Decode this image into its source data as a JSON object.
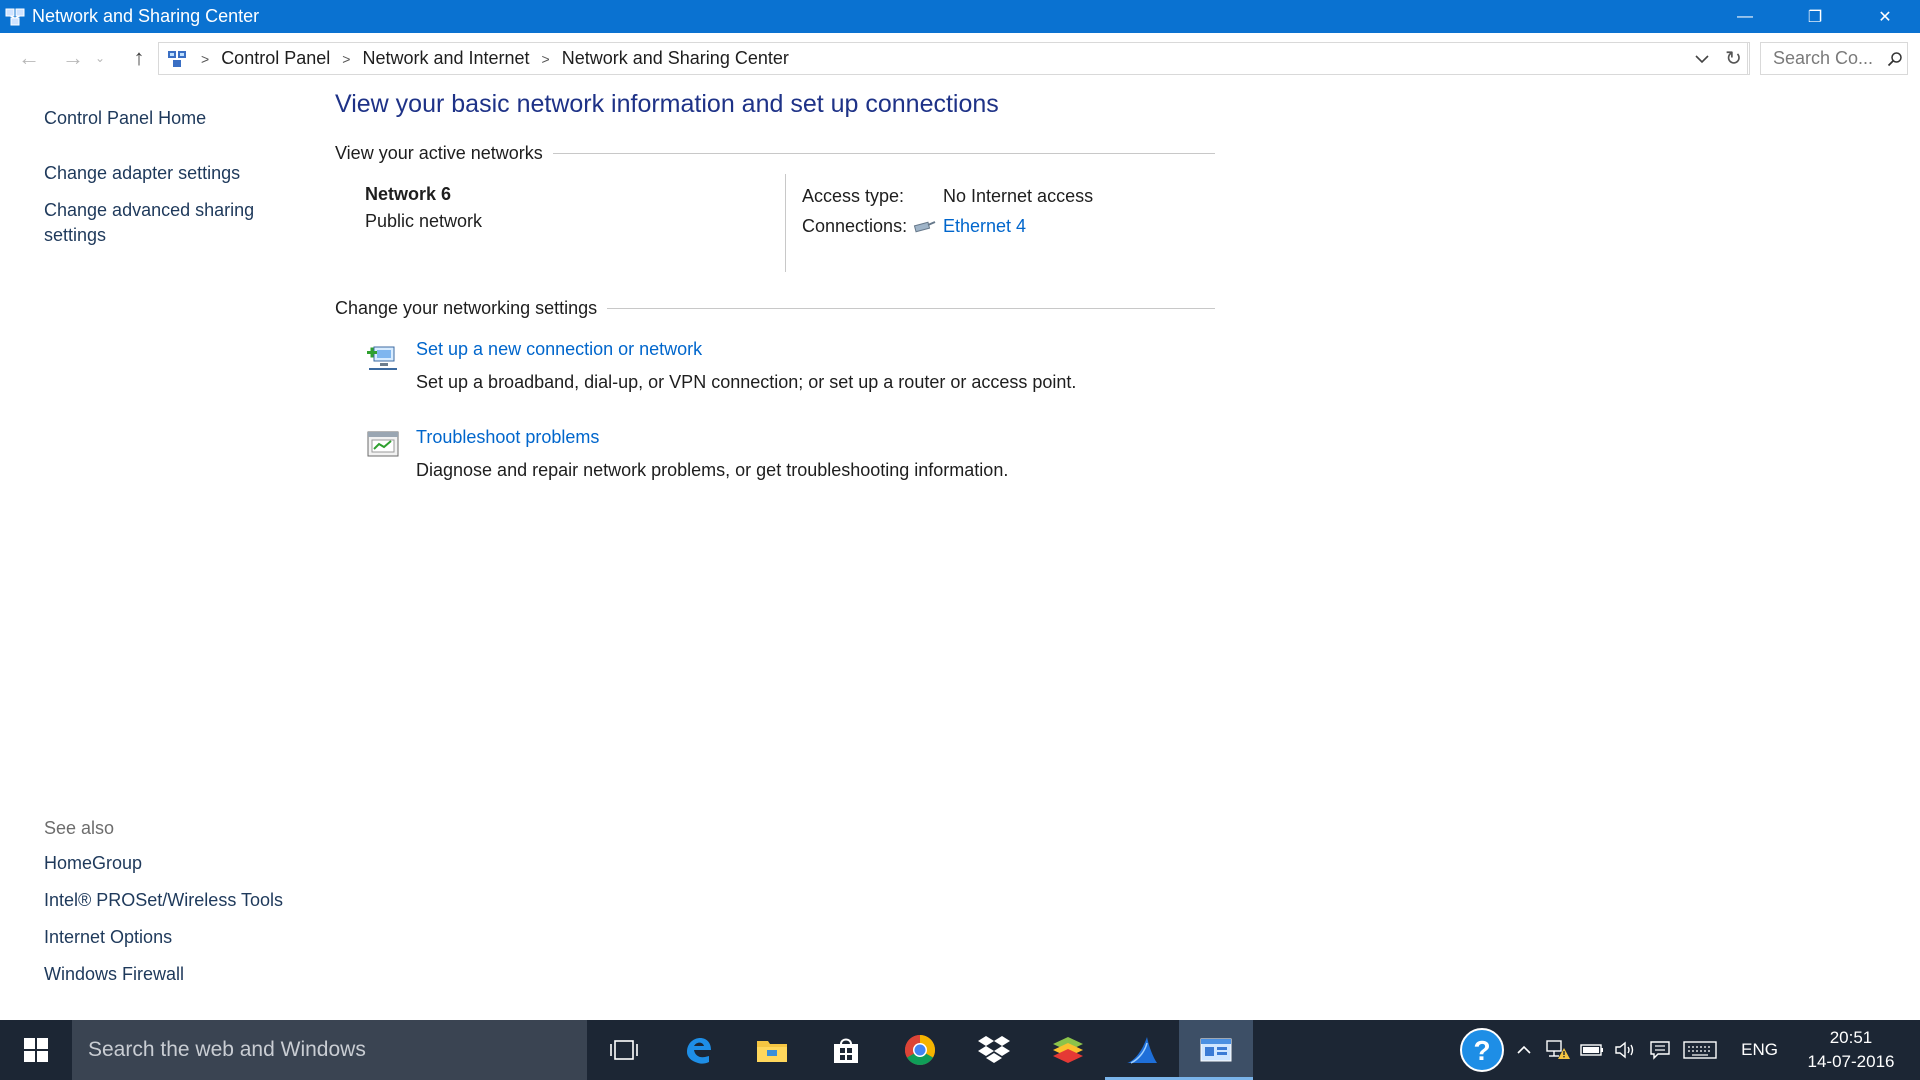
{
  "window": {
    "title": "Network and Sharing Center",
    "minimize": "—",
    "restore": "❐",
    "close": "✕"
  },
  "address": {
    "breadcrumbs": [
      "Control Panel",
      "Network and Internet",
      "Network and Sharing Center"
    ],
    "search_placeholder": "Search Co..."
  },
  "left_pane": {
    "home": "Control Panel Home",
    "links": [
      "Change adapter settings",
      "Change advanced sharing settings"
    ],
    "see_also_title": "See also",
    "see_also": [
      "HomeGroup",
      "Intel® PROSet/Wireless Tools",
      "Internet Options",
      "Windows Firewall"
    ]
  },
  "main": {
    "title": "View your basic network information and set up connections",
    "active_networks_heading": "View your active networks",
    "network": {
      "name": "Network  6",
      "type": "Public network",
      "access_type_label": "Access type:",
      "access_type_value": "No Internet access",
      "connections_label": "Connections:",
      "connection_name": "Ethernet 4"
    },
    "change_settings_heading": "Change your networking settings",
    "tasks": [
      {
        "link": "Set up a new connection or network",
        "description": "Set up a broadband, dial-up, or VPN connection; or set up a router or access point.",
        "icon": "new-connection-icon"
      },
      {
        "link": "Troubleshoot problems",
        "description": "Diagnose and repair network problems, or get troubleshooting information.",
        "icon": "troubleshoot-icon"
      }
    ]
  },
  "taskbar": {
    "search_placeholder": "Search the web and Windows",
    "apps": [
      "task-view-icon",
      "edge-icon",
      "file-explorer-icon",
      "store-icon",
      "chrome-icon",
      "dropbox-icon",
      "bluestacks-icon",
      "wireshark-icon",
      "control-panel-icon"
    ],
    "language": "ENG",
    "time": "20:51",
    "date": "14-07-2016"
  },
  "colors": {
    "titlebar": "#0a72d1",
    "link": "#0066cc",
    "heading": "#1e3287",
    "taskbar": "#1c2634"
  }
}
